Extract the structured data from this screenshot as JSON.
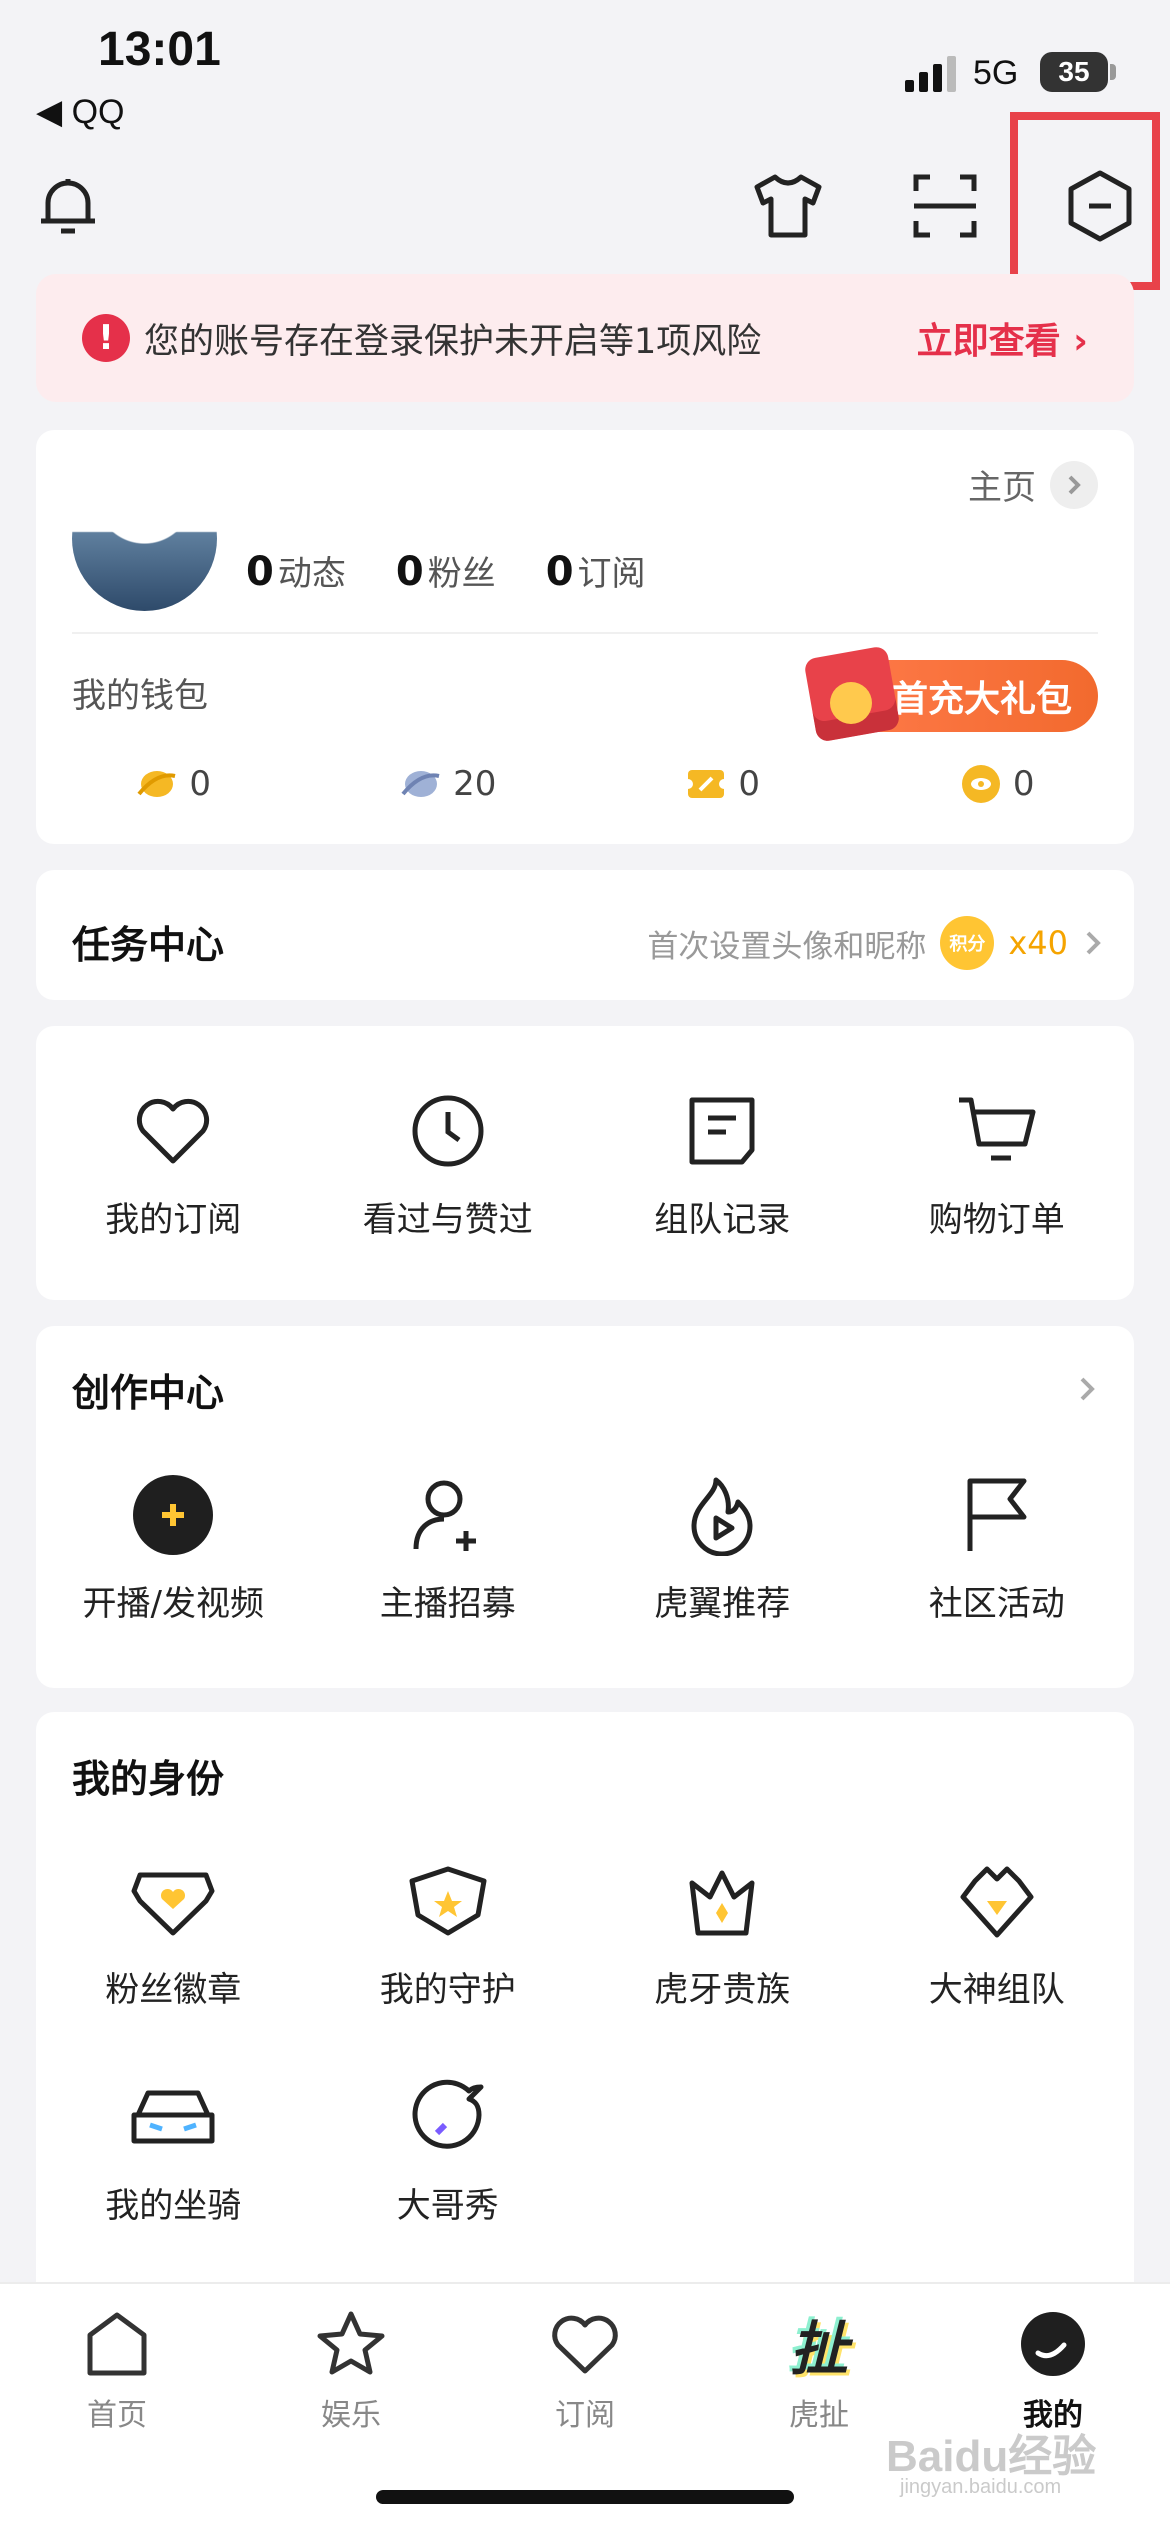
{
  "status_bar": {
    "time": "13:01",
    "back_app": "◀ QQ",
    "network": "5G",
    "battery": "35"
  },
  "top_bar": {
    "icons": [
      "bell-icon",
      "shirt-icon",
      "scan-icon",
      "settings-hexagon-icon"
    ]
  },
  "risk_banner": {
    "text": "您的账号存在登录保护未开启等1项风险",
    "link": "立即查看 ›"
  },
  "profile": {
    "stats": [
      {
        "num": "0",
        "label": "动态"
      },
      {
        "num": "0",
        "label": "粉丝"
      },
      {
        "num": "0",
        "label": "订阅"
      }
    ],
    "home_link": "主页",
    "wallet_label": "我的钱包",
    "gift_button": "首充大礼包",
    "wallet": [
      {
        "icon": "gold-bean-icon",
        "value": "0"
      },
      {
        "icon": "silver-bean-icon",
        "value": "20"
      },
      {
        "icon": "ticket-icon",
        "value": "0"
      },
      {
        "icon": "coin-icon",
        "value": "0"
      }
    ]
  },
  "task_center": {
    "title": "任务中心",
    "hint": "首次设置头像和昵称",
    "badge": "积分",
    "reward": "x40"
  },
  "quick_links": [
    {
      "icon": "heart-icon",
      "label": "我的订阅"
    },
    {
      "icon": "clock-icon",
      "label": "看过与赞过"
    },
    {
      "icon": "team-record-icon",
      "label": "组队记录"
    },
    {
      "icon": "cart-icon",
      "label": "购物订单"
    }
  ],
  "creation_center": {
    "title": "创作中心",
    "items": [
      {
        "icon": "plus-circle-icon",
        "label": "开播/发视频"
      },
      {
        "icon": "add-user-icon",
        "label": "主播招募"
      },
      {
        "icon": "flame-play-icon",
        "label": "虎翼推荐"
      },
      {
        "icon": "flag-icon",
        "label": "社区活动"
      }
    ]
  },
  "identity": {
    "title": "我的身份",
    "items": [
      {
        "icon": "fan-badge-icon",
        "label": "粉丝徽章"
      },
      {
        "icon": "guard-icon",
        "label": "我的守护"
      },
      {
        "icon": "crown-icon",
        "label": "虎牙贵族"
      },
      {
        "icon": "diamond-crown-icon",
        "label": "大神组队"
      },
      {
        "icon": "car-icon",
        "label": "我的坐骑"
      },
      {
        "icon": "bubble-icon",
        "label": "大哥秀"
      }
    ]
  },
  "tab_bar": [
    {
      "icon": "home-icon",
      "label": "首页"
    },
    {
      "icon": "star-icon",
      "label": "娱乐"
    },
    {
      "icon": "heart-icon",
      "label": "订阅"
    },
    {
      "icon": "huche-icon",
      "label": "虎扯",
      "glyph": "扯"
    },
    {
      "icon": "profile-icon",
      "label": "我的"
    }
  ],
  "watermark": {
    "main": "Baidu经验",
    "sub": "jingyan.baidu.com"
  }
}
